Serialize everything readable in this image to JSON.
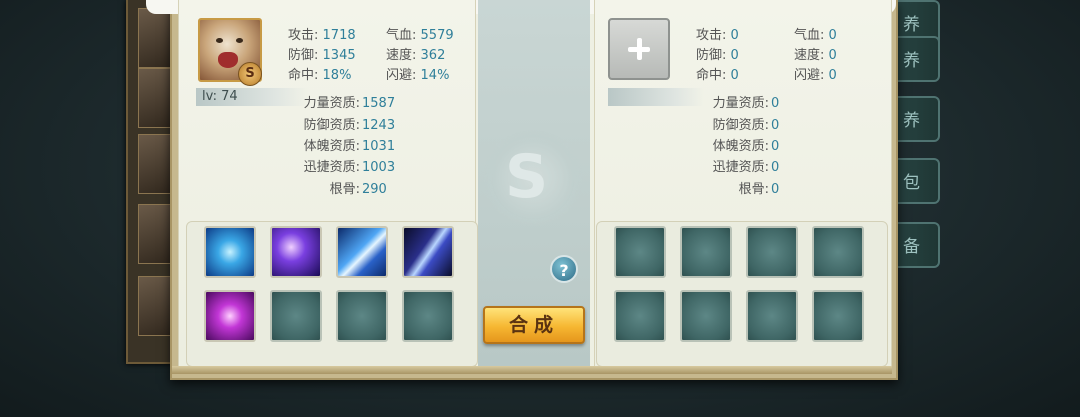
{
  "side_tabs": [
    "果养",
    "训养",
    "背包",
    "装备"
  ],
  "pet": {
    "grade": "S",
    "level_label": "lv: 74",
    "stats": {
      "attack_label": "攻击:",
      "attack": "1718",
      "hp_label": "气血:",
      "hp": "5579",
      "defense_label": "防御:",
      "defense": "1345",
      "speed_label": "速度:",
      "speed": "362",
      "hit_label": "命中:",
      "hit": "18%",
      "dodge_label": "闪避:",
      "dodge": "14%"
    },
    "aptitudes": {
      "strength_label": "力量资质:",
      "strength": "1587",
      "defense_label": "防御资质:",
      "defense": "1243",
      "physique_label": "体魄资质:",
      "physique": "1031",
      "agility_label": "迅捷资质:",
      "agility": "1003",
      "root_label": "根骨:",
      "root": "290"
    }
  },
  "target": {
    "stats": {
      "attack_label": "攻击:",
      "attack": "0",
      "hp_label": "气血:",
      "hp": "0",
      "defense_label": "防御:",
      "defense": "0",
      "speed_label": "速度:",
      "speed": "0",
      "hit_label": "命中:",
      "hit": "0",
      "dodge_label": "闪避:",
      "dodge": "0"
    },
    "aptitudes": {
      "strength_label": "力量资质:",
      "strength": "0",
      "defense_label": "防御资质:",
      "defense": "0",
      "physique_label": "体魄资质:",
      "physique": "0",
      "agility_label": "迅捷资质:",
      "agility": "0",
      "root_label": "根骨:",
      "root": "0"
    }
  },
  "buttons": {
    "help": "?",
    "compose": "合成"
  },
  "skill_icons_left": [
    "blue-seal-skill-icon",
    "purple-vortex-skill-icon",
    "blue-arrow-skill-icon",
    "claw-slash-skill-icon",
    "magenta-seal-skill-icon",
    "empty-skill-slot",
    "empty-skill-slot",
    "empty-skill-slot"
  ],
  "colors": {
    "value_text": "#2f7f9a",
    "label_text": "#555555",
    "compose_button": "#f6b732"
  }
}
